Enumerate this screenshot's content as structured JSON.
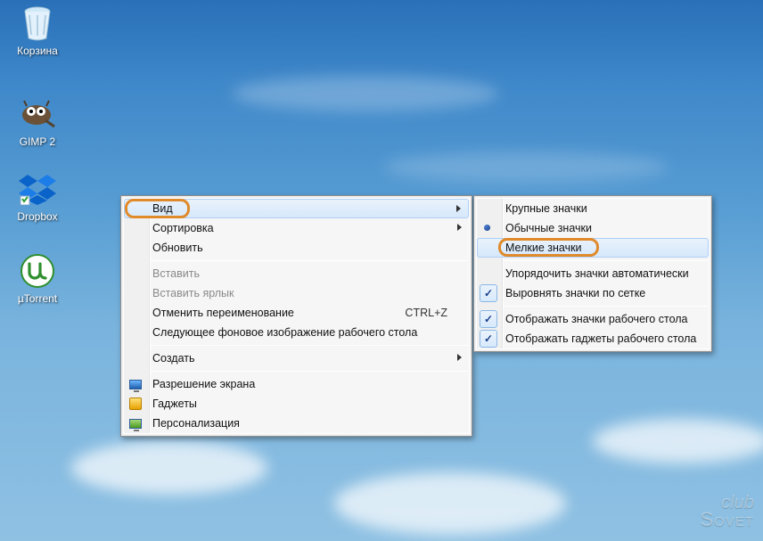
{
  "desktop": {
    "icons": [
      {
        "label": "Корзина"
      },
      {
        "label": "GIMP 2"
      },
      {
        "label": "Dropbox"
      },
      {
        "label": "µTorrent"
      }
    ]
  },
  "context_menu": {
    "view": "Вид",
    "sort": "Сортировка",
    "refresh": "Обновить",
    "paste": "Вставить",
    "paste_shortcut": "Вставить ярлык",
    "undo_rename": "Отменить переименование",
    "undo_rename_shortcut": "CTRL+Z",
    "next_bg": "Следующее фоновое изображение рабочего стола",
    "create": "Создать",
    "resolution": "Разрешение экрана",
    "gadgets": "Гаджеты",
    "personalize": "Персонализация"
  },
  "view_submenu": {
    "large_icons": "Крупные значки",
    "medium_icons": "Обычные значки",
    "small_icons": "Мелкие значки",
    "auto_arrange": "Упорядочить значки автоматически",
    "align_grid": "Выровнять значки по сетке",
    "show_icons": "Отображать значки рабочего стола",
    "show_gadgets": "Отображать гаджеты  рабочего стола"
  },
  "watermark": {
    "line1": "club",
    "line2": "Sovet"
  }
}
